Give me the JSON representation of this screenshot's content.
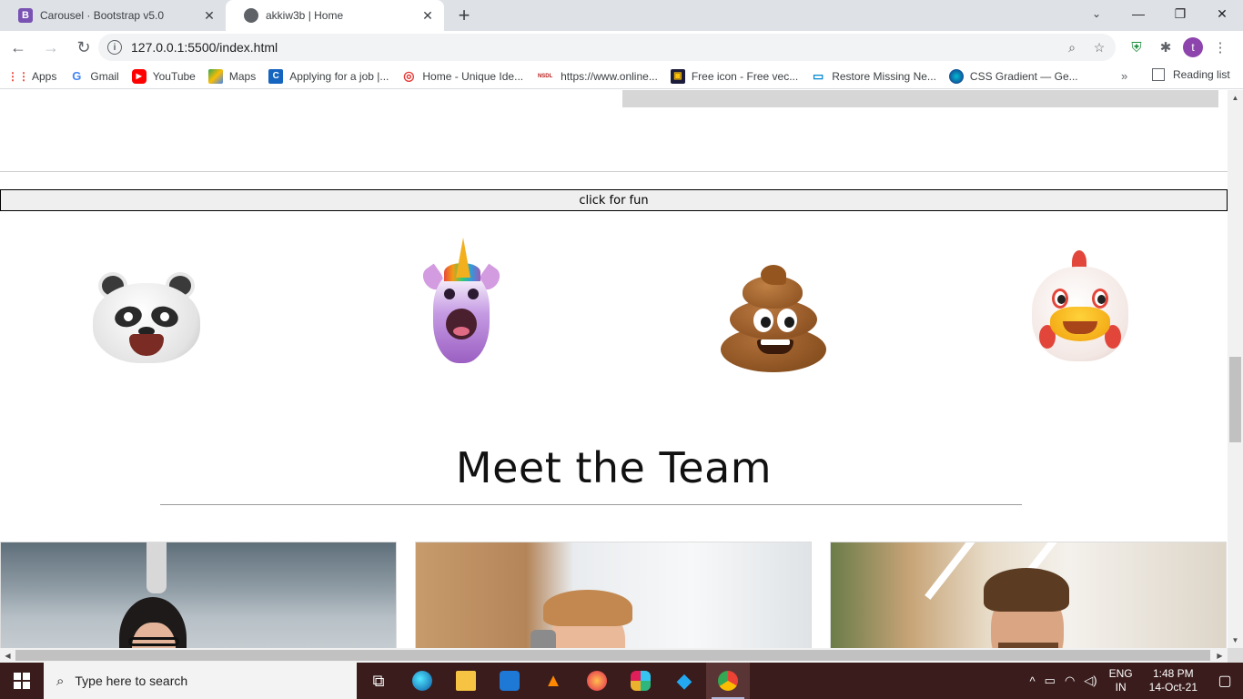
{
  "browser": {
    "tabs": [
      {
        "title": "Carousel · Bootstrap v5.0",
        "favicon": "B",
        "active": false
      },
      {
        "title": "akkiw3b | Home",
        "active": true
      }
    ],
    "url": "127.0.0.1:5500/index.html",
    "bookmarks": [
      {
        "label": "Apps",
        "icon": "apps-grid-icon"
      },
      {
        "label": "Gmail",
        "icon": "google-icon",
        "glyph": "G"
      },
      {
        "label": "YouTube",
        "icon": "youtube-icon"
      },
      {
        "label": "Maps",
        "icon": "maps-icon"
      },
      {
        "label": "Applying for a job |...",
        "icon": "c-icon",
        "glyph": "C"
      },
      {
        "label": "Home - Unique Ide...",
        "icon": "fingerprint-icon"
      },
      {
        "label": "https://www.online...",
        "icon": "nsdl-icon",
        "glyph": "NSDL"
      },
      {
        "label": "Free icon - Free vec...",
        "icon": "flaticon-icon"
      },
      {
        "label": "Restore Missing Ne...",
        "icon": "monitor-icon"
      },
      {
        "label": "CSS Gradient — Ge...",
        "icon": "gradient-icon"
      }
    ],
    "bookmarks_overflow": "»",
    "reading_list": "Reading list",
    "avatar_letter": "t"
  },
  "page": {
    "fun_button": "click for fun",
    "emojis": [
      "panda",
      "unicorn",
      "pile-of-poo",
      "chicken"
    ],
    "team_title": "Meet the Team"
  },
  "taskbar": {
    "search_placeholder": "Type here to search",
    "language": "ENG",
    "region": "IN",
    "time": "1:48 PM",
    "date": "14-Oct-21"
  },
  "colors": {
    "taskbar_bg": "#3a1c1c",
    "tabstrip_bg": "#dee1e6",
    "button_bg": "#efefef"
  }
}
